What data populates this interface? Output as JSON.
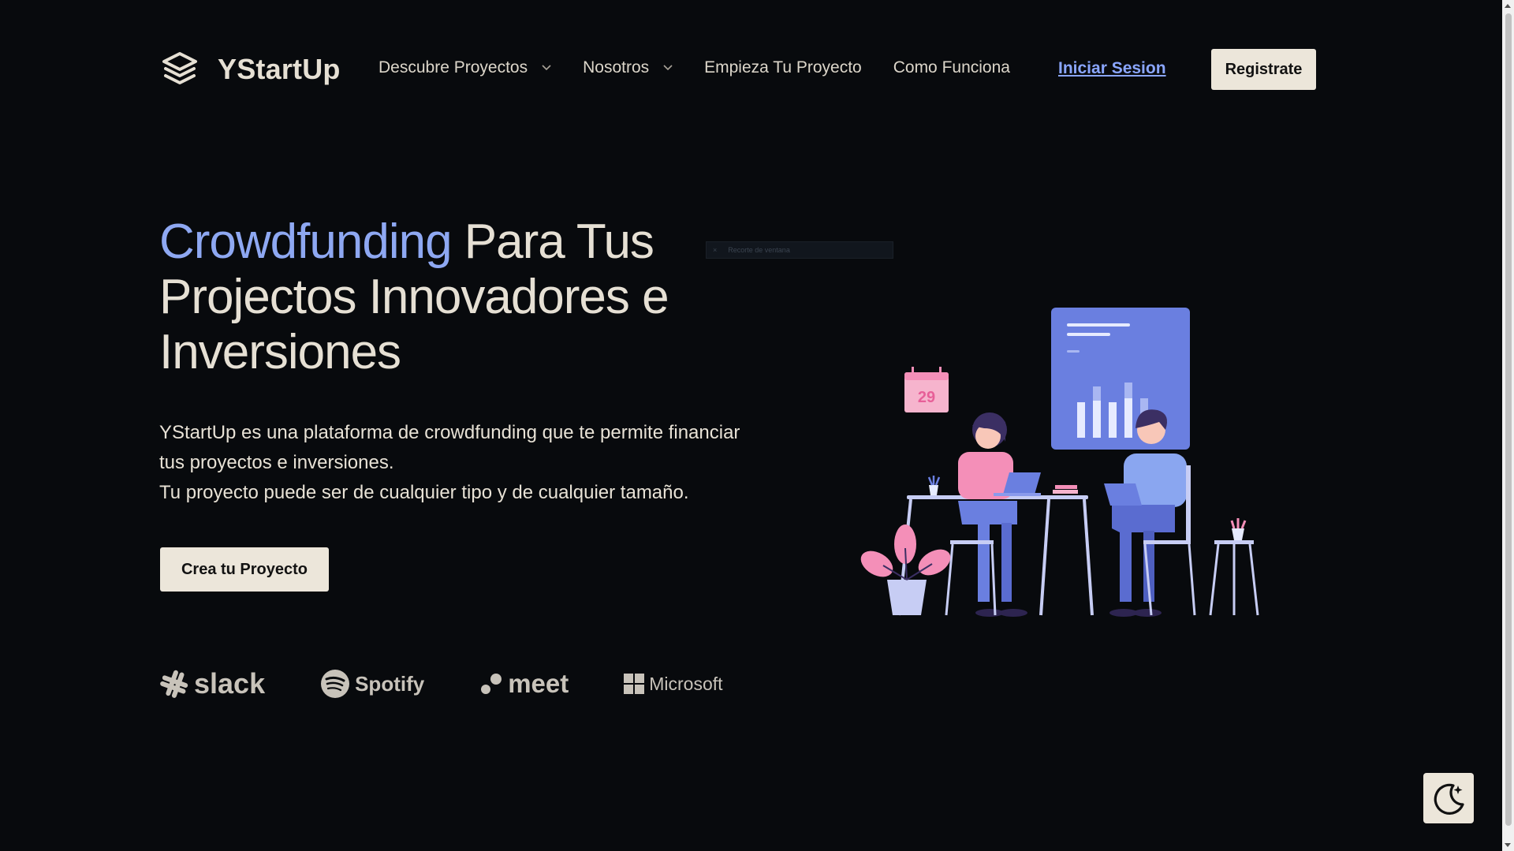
{
  "brand": {
    "name": "YStartUp",
    "logo_icon": "stacked-layers-icon"
  },
  "nav": {
    "items": [
      {
        "label": "Descubre Proyectos",
        "has_dropdown": true
      },
      {
        "label": "Nosotros",
        "has_dropdown": true
      },
      {
        "label": "Empieza Tu Proyecto",
        "has_dropdown": false
      },
      {
        "label": "Como Funciona",
        "has_dropdown": false
      }
    ],
    "login_label": "Iniciar Sesion",
    "register_label": "Registrate"
  },
  "hero": {
    "title_accent": "Crowdfunding",
    "title_rest": " Para Tus Projectos Innovadores e Inversiones",
    "description_line1": "YStartUp es una plataforma de crowdfunding que te permite financiar tus proyectos e inversiones.",
    "description_line2": "Tu proyecto puede ser de cualquier tipo y de cualquier tamaño.",
    "cta_label": "Crea tu Proyecto"
  },
  "snip_overlay": {
    "text": "Recorte de ventana"
  },
  "illustration": {
    "calendar_day": "29"
  },
  "partners": {
    "slack": "slack",
    "spotify": "Spotify",
    "meet": "meet",
    "microsoft": "Microsoft"
  },
  "colors": {
    "background": "#080a0d",
    "accent": "#8ea8f2",
    "link": "#8aa6ff",
    "button_bg": "#ece6da",
    "illustration_blue": "#6a7fe0",
    "illustration_pink": "#f48fb8"
  },
  "theme_toggle": {
    "icon": "moon-sparkle-icon"
  }
}
